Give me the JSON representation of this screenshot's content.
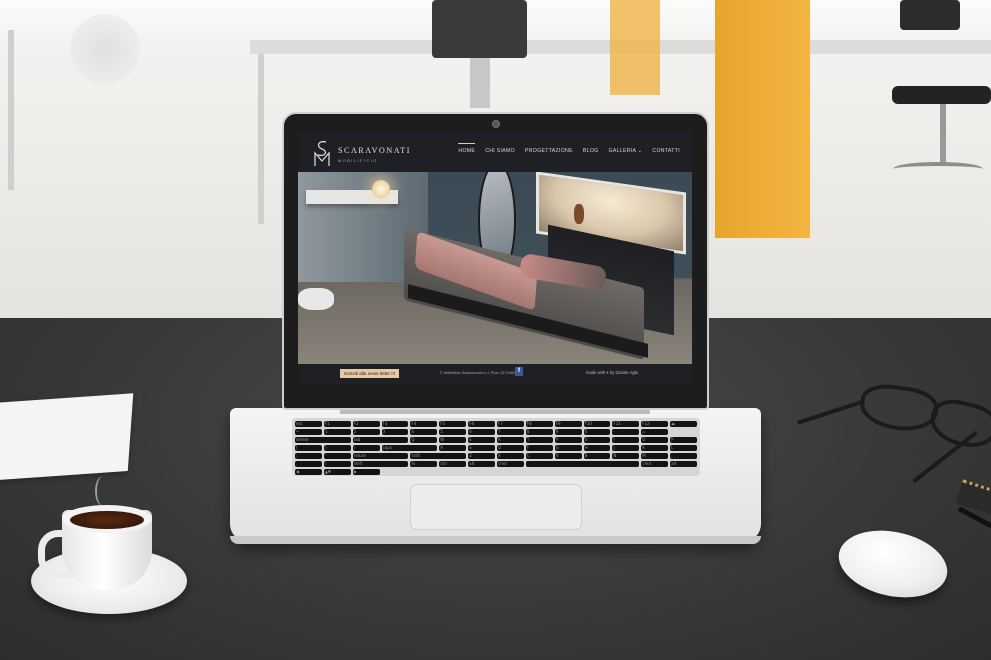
{
  "site": {
    "brand": "SCARAVONATI",
    "brand_sub": "MOBILIFICIO",
    "nav": [
      {
        "label": "HOME",
        "active": true
      },
      {
        "label": "CHI SIAMO",
        "active": false
      },
      {
        "label": "PROGETTAZIONE",
        "active": false
      },
      {
        "label": "BLOG",
        "active": false
      },
      {
        "label": "GALLERIA",
        "active": false
      },
      {
        "label": "CONTATTI",
        "active": false
      }
    ],
    "footer": {
      "newsletter_label": "Iscriviti alla news letter !!!",
      "copyright": "© Mobilificio Scaravonati s.r.l. Piva: 02734820165",
      "facebook_glyph": "f",
      "made_with": "made with",
      "made_by": "Davide Agla"
    }
  },
  "keyboard": {
    "rows": [
      [
        "esc",
        "F1",
        "F2",
        "F3",
        "F4",
        "F5",
        "F6",
        "F7",
        "F8",
        "F9",
        "F10",
        "F11",
        "F12",
        "⏏"
      ],
      [
        "~",
        "1",
        "2",
        "3",
        "4",
        "5",
        "6",
        "7",
        "8",
        "9",
        "0",
        "-",
        "=",
        "delete"
      ],
      [
        "tab",
        "Q",
        "W",
        "E",
        "R",
        "T",
        "Y",
        "U",
        "I",
        "O",
        "P",
        "[",
        "]",
        "\\"
      ],
      [
        "caps",
        "A",
        "S",
        "D",
        "F",
        "G",
        "H",
        "J",
        "K",
        "L",
        ";",
        "'",
        "return"
      ],
      [
        "shift",
        "Z",
        "X",
        "C",
        "V",
        "B",
        "N",
        "M",
        ",",
        ".",
        "/",
        "shift"
      ],
      [
        "fn",
        "ctrl",
        "alt",
        "cmd",
        "",
        "cmd",
        "alt",
        "◀",
        "▲▼",
        "▶"
      ]
    ]
  },
  "colors": {
    "accent": "#e7c8a6",
    "pillar": "#f3b541",
    "desk": "#393939"
  },
  "icons": {
    "gallery_chevron": "chevron-down-icon",
    "logo": "monogram-sm-icon"
  }
}
